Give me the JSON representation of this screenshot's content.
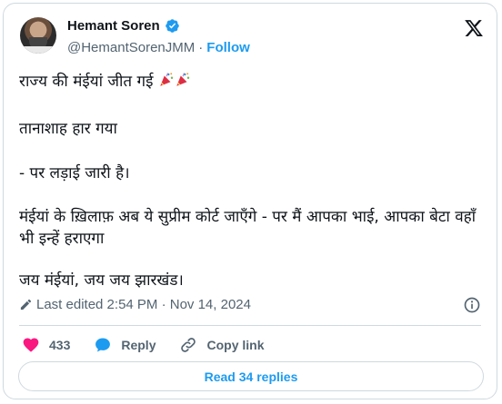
{
  "author": {
    "name": "Hemant Soren",
    "handle": "@HemantSorenJMM",
    "separator": "·",
    "follow_label": "Follow"
  },
  "tweet": {
    "line1": "राज्य की मंईयां जीत गई",
    "line2": "तानाशाह हार गया",
    "line3": "- पर लड़ाई जारी है।",
    "line4": " मंईयां के ख़िलाफ़ अब ये सुप्रीम कोर्ट जाएँगे - पर मैं आपका भाई, आपका बेटा वहाँ भी इन्हें हराएगा",
    "line5": "जय मंईयां, जय जय झारखंड।"
  },
  "meta": {
    "edited_text": "Last edited 2:54 PM · Nov 14, 2024"
  },
  "actions": {
    "likes_count": "433",
    "reply_label": "Reply",
    "copy_link_label": "Copy link"
  },
  "replies": {
    "label": "Read 34 replies"
  },
  "colors": {
    "accent": "#1d9bf0",
    "like": "#f91880",
    "muted": "#536471",
    "border": "#cfd9de"
  }
}
